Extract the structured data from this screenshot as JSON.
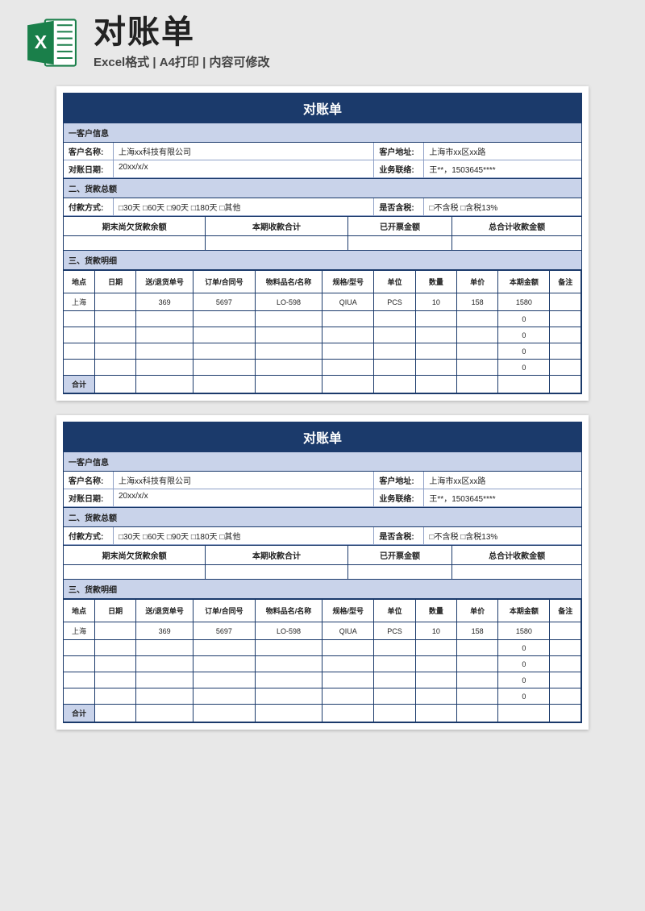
{
  "header": {
    "title": "对账单",
    "subtitle": "Excel格式 | A4打印 | 内容可修改",
    "icon_label": "X"
  },
  "doc": {
    "title": "对账单",
    "section1": "一客户信息",
    "customer_name_label": "客户名称:",
    "customer_name": "上海xx科技有限公司",
    "customer_addr_label": "客户地址:",
    "customer_addr": "上海市xx区xx路",
    "recon_date_label": "对账日期:",
    "recon_date": "20xx/x/x",
    "contact_label": "业务联络:",
    "contact": "王**，1503645****",
    "section2": "二、货款总额",
    "pay_method_label": "付款方式:",
    "pay_method": "□30天 □60天 □90天 □180天 □其他",
    "tax_label": "是否含税:",
    "tax_value": "□不含税   □含税13%",
    "sum_head": {
      "a": "期末尚欠货款余额",
      "b": "本期收款合计",
      "c": "已开票金额",
      "d": "总合计收款金额"
    },
    "section3": "三、货款明细",
    "cols": {
      "loc": "地点",
      "date": "日期",
      "ret": "送/退货单号",
      "ord": "订单/合同号",
      "mat": "物料品名/名称",
      "spec": "规格/型号",
      "unit": "单位",
      "qty": "数量",
      "price": "单价",
      "amt": "本期金额",
      "note": "备注"
    },
    "rows": [
      {
        "loc": "上海",
        "date": "",
        "ret": "369",
        "ord": "5697",
        "mat": "LO-598",
        "spec": "QIUA",
        "unit": "PCS",
        "qty": "10",
        "price": "158",
        "amt": "1580",
        "note": ""
      },
      {
        "loc": "",
        "date": "",
        "ret": "",
        "ord": "",
        "mat": "",
        "spec": "",
        "unit": "",
        "qty": "",
        "price": "",
        "amt": "0",
        "note": ""
      },
      {
        "loc": "",
        "date": "",
        "ret": "",
        "ord": "",
        "mat": "",
        "spec": "",
        "unit": "",
        "qty": "",
        "price": "",
        "amt": "0",
        "note": ""
      },
      {
        "loc": "",
        "date": "",
        "ret": "",
        "ord": "",
        "mat": "",
        "spec": "",
        "unit": "",
        "qty": "",
        "price": "",
        "amt": "0",
        "note": ""
      },
      {
        "loc": "",
        "date": "",
        "ret": "",
        "ord": "",
        "mat": "",
        "spec": "",
        "unit": "",
        "qty": "",
        "price": "",
        "amt": "0",
        "note": ""
      }
    ],
    "total_label": "合计"
  }
}
